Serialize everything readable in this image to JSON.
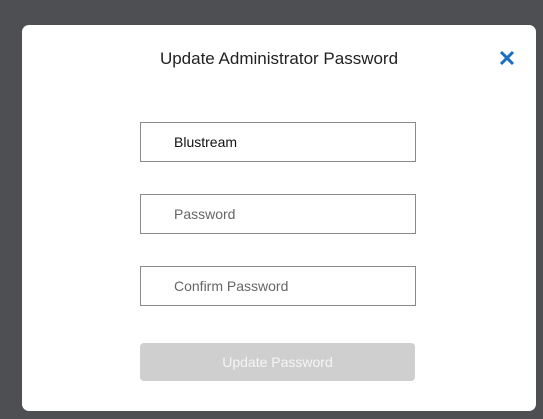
{
  "dialog": {
    "title": "Update Administrator Password",
    "close_icon": "close-icon",
    "accent_color": "#1a6fc4"
  },
  "form": {
    "username_value": "Blustream",
    "password_placeholder": "Password",
    "confirm_placeholder": "Confirm Password",
    "submit_label": "Update Password",
    "submit_disabled_color": "#cfcfcf"
  }
}
